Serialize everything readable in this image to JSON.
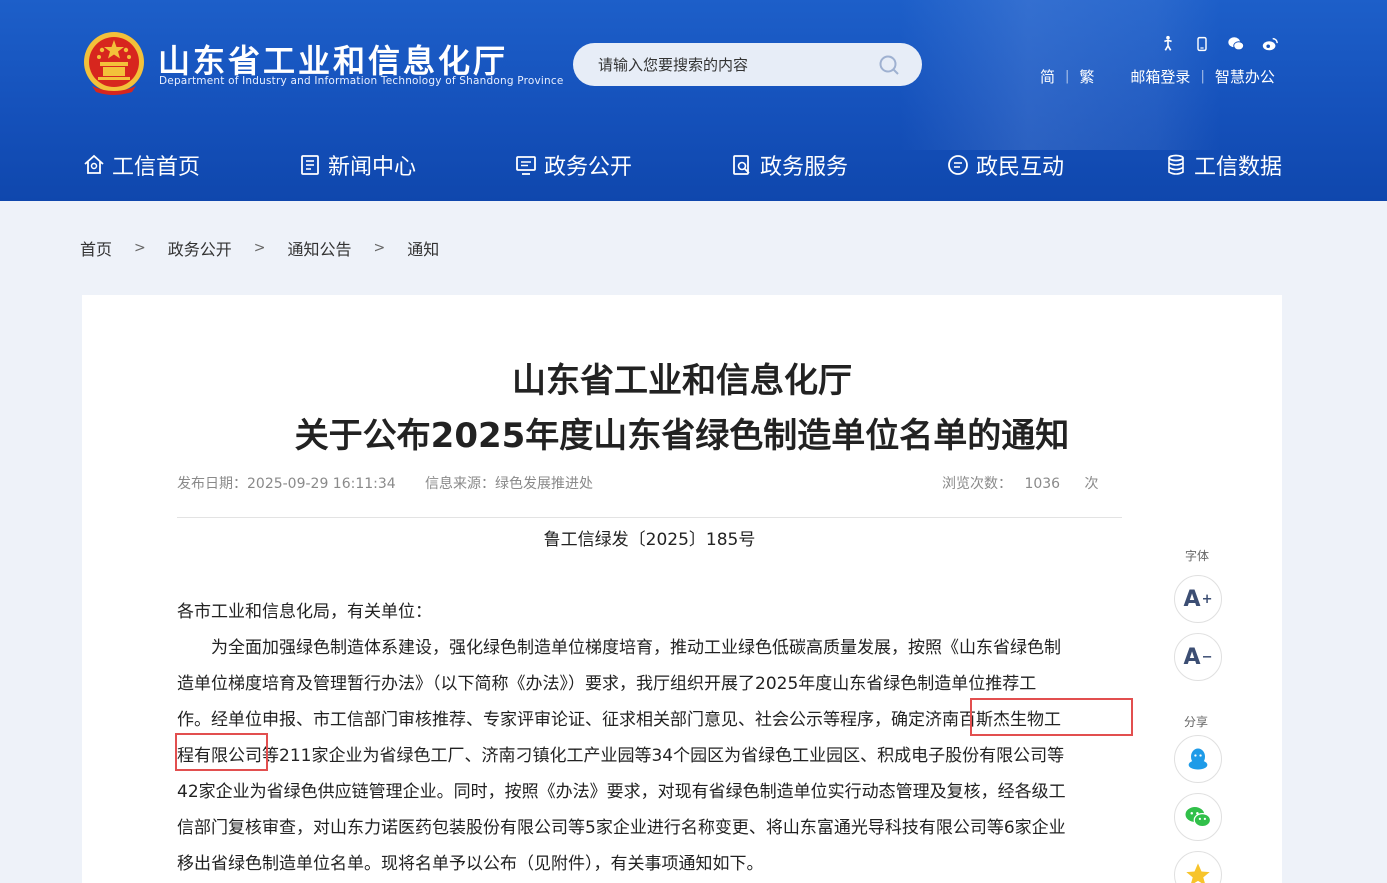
{
  "header": {
    "site_title": "山东省工业和信息化厅",
    "site_subtitle": "Department of Industry and Information Technology of Shandong Province",
    "search_placeholder": "请输入您要搜索的内容",
    "top_icons": [
      "accessibility-icon",
      "mobile-icon",
      "wechat-icon",
      "weibo-icon"
    ],
    "links": {
      "simplified": "简",
      "traditional": "繁",
      "mail_login": "邮箱登录",
      "smart_office": "智慧办公",
      "sep": "|"
    }
  },
  "nav": [
    {
      "label": "工信首页",
      "icon": "home-icon"
    },
    {
      "label": "新闻中心",
      "icon": "news-icon"
    },
    {
      "label": "政务公开",
      "icon": "monitor-icon"
    },
    {
      "label": "政务服务",
      "icon": "service-icon"
    },
    {
      "label": "政民互动",
      "icon": "chat-icon"
    },
    {
      "label": "工信数据",
      "icon": "database-icon"
    }
  ],
  "breadcrumb": {
    "items": [
      "首页",
      "政务公开",
      "通知公告",
      "通知"
    ],
    "sep": ">"
  },
  "article": {
    "title_line1": "山东省工业和信息化厅",
    "title_line2": "关于公布2025年度山东省绿色制造单位名单的通知",
    "meta": {
      "date_label": "发布日期：",
      "date": "2025-09-29 16:11:34",
      "source_label": "信息来源：",
      "source": "绿色发展推进处",
      "views_label": "浏览次数：",
      "views": "1036",
      "views_unit": "次"
    },
    "doc_number": "鲁工信绿发〔2025〕185号",
    "addressee": "各市工业和信息化局，有关单位：",
    "body_lines": [
      "　　为全面加强绿色制造体系建设，强化绿色制造单位梯度培育，推动工业绿色低碳高质量发展，按照《山东省绿色制",
      "造单位梯度培育及管理暂行办法》（以下简称《办法》）要求，我厅组织开展了2025年度山东省绿色制造单位推荐工",
      "作。经单位申报、市工信部门审核推荐、专家评审论证、征求相关部门意见、社会公示等程序，确定济南百斯杰生物工",
      "程有限公司等211家企业为省绿色工厂、济南刁镇化工产业园等34个园区为省绿色工业园区、积成电子股份有限公司等",
      "42家企业为省绿色供应链管理企业。同时，按照《办法》要求，对现有省绿色制造单位实行动态管理及复核，经各级工",
      "信部门复核审查，对山东力诺医药包装股份有限公司等5家企业进行名称变更、将山东富通光导科技有限公司等6家企业",
      "移出省绿色制造单位名单。现将名单予以公布（见附件），有关事项通知如下。"
    ]
  },
  "side_tools": {
    "font_label": "字体",
    "font_increase": "A",
    "font_increase_sup": "+",
    "font_decrease": "A",
    "font_decrease_sup": "−",
    "share_label": "分享",
    "share_targets": [
      "qq-icon",
      "wechat-share-icon",
      "qzone-icon"
    ]
  },
  "colors": {
    "header_blue": "#1551bb",
    "highlight_red": "#e24f4f",
    "page_bg": "#eef2f9"
  }
}
